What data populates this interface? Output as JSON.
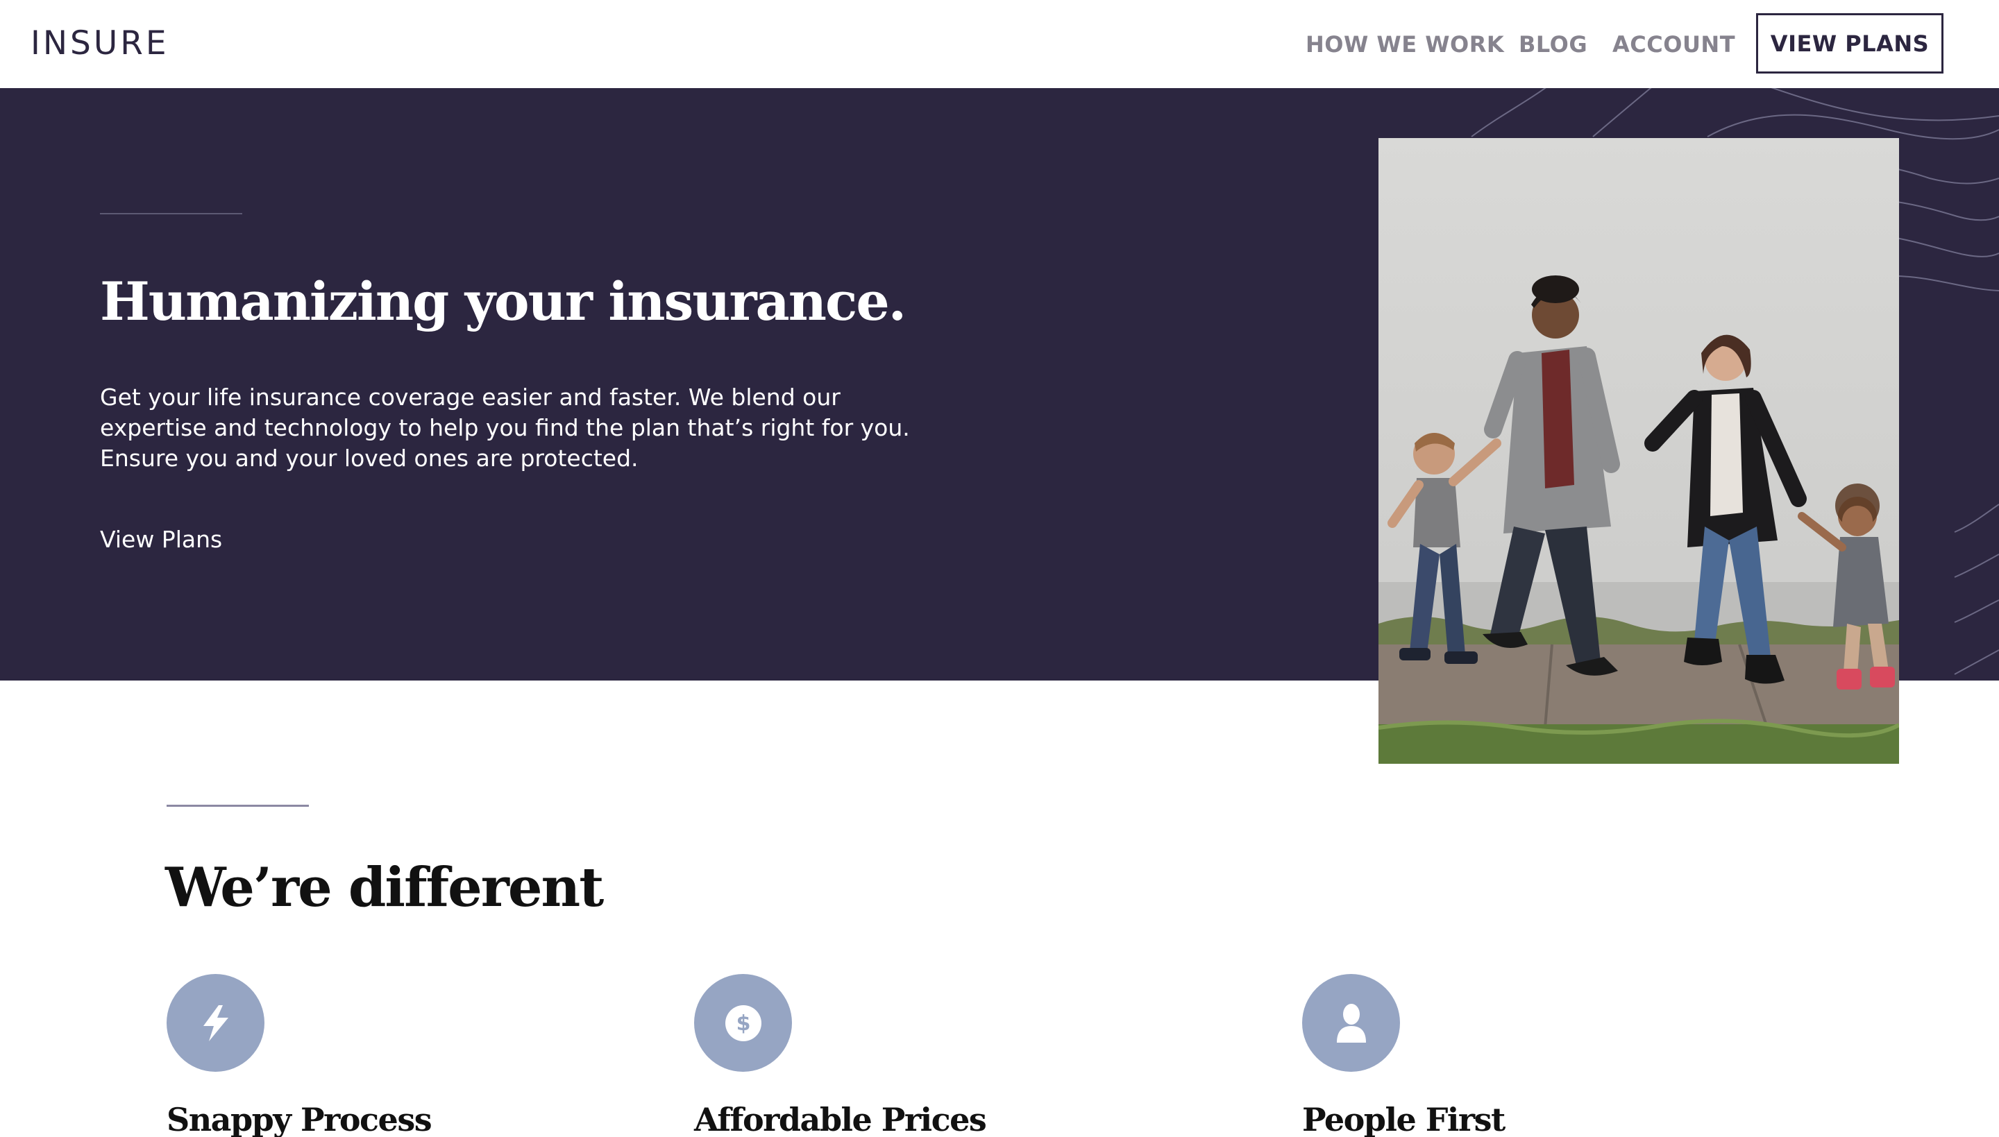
{
  "header": {
    "logo": "INSURE",
    "nav": {
      "how_we_work": "HOW WE WORK",
      "blog": "BLOG",
      "account": "ACCOUNT"
    },
    "cta": "VIEW PLANS"
  },
  "hero": {
    "title": "Humanizing your insurance.",
    "text": "Get your life insurance coverage easier and faster. We blend our expertise and technology to help you find the plan that’s right for you. Ensure you and your loved ones are protected.",
    "link": "View Plans",
    "colors": {
      "background": "#2c2640",
      "text": "#ffffff"
    }
  },
  "different": {
    "title": "We’re different",
    "features": [
      {
        "icon": "lightning-bolt-icon",
        "title": "Snappy Process"
      },
      {
        "icon": "dollar-coin-icon",
        "title": "Affordable Prices"
      },
      {
        "icon": "person-icon",
        "title": "People First"
      }
    ],
    "colors": {
      "icon_circle": "#96a5c3"
    }
  }
}
